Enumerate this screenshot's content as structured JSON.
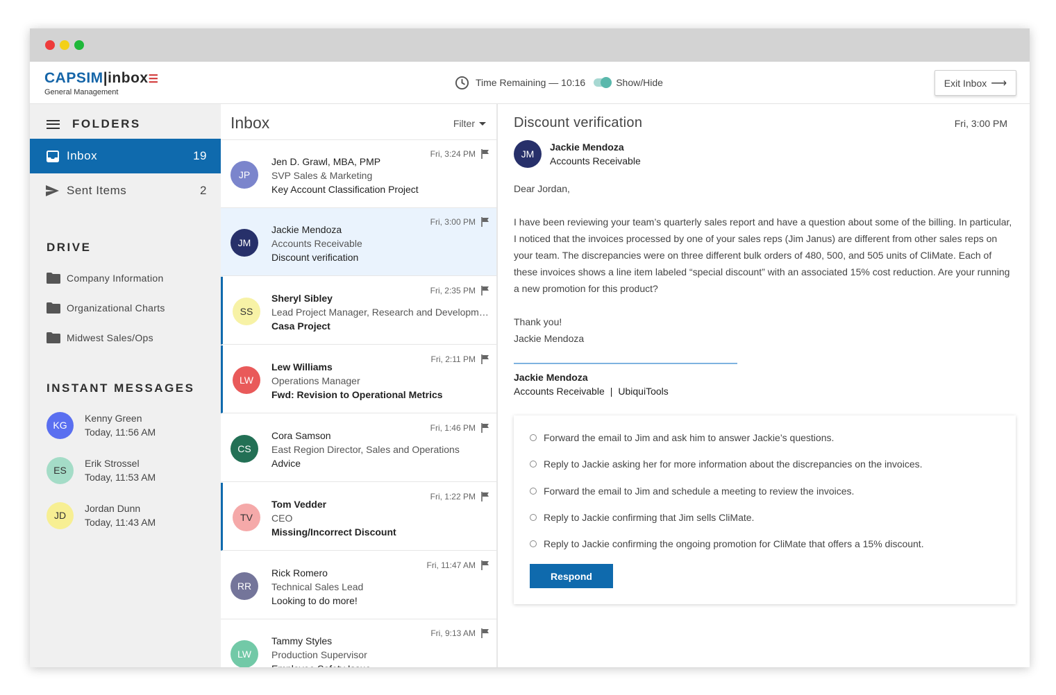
{
  "header": {
    "logo_brand": "CAPSIM",
    "logo_product": "inbox",
    "logo_subtitle": "General Management",
    "timer_label": "Time Remaining — 10:16",
    "toggle_label": "Show/Hide",
    "exit_label": "Exit Inbox",
    "colors": {
      "brand": "#1565a8",
      "toggle": "#5ab8ac"
    }
  },
  "sidebar": {
    "folders_title": "FOLDERS",
    "folders": [
      {
        "label": "Inbox",
        "count": "19",
        "icon": "inbox-icon",
        "active": true
      },
      {
        "label": "Sent Items",
        "count": "2",
        "icon": "send-icon",
        "active": false
      }
    ],
    "drive_title": "DRIVE",
    "drive": [
      {
        "label": "Company Information",
        "icon": "folder-icon"
      },
      {
        "label": "Organizational Charts",
        "icon": "folder-icon"
      },
      {
        "label": "Midwest Sales/Ops",
        "icon": "folder-icon"
      }
    ],
    "im_title": "INSTANT MESSAGES",
    "messages": [
      {
        "initials": "KG",
        "name": "Kenny Green",
        "time": "Today, 11:56 AM",
        "bg": "#5a6ff0",
        "fg": "#ffffff"
      },
      {
        "initials": "ES",
        "name": "Erik Strossel",
        "time": "Today, 11:53 AM",
        "bg": "#a4dcc7",
        "fg": "#333333"
      },
      {
        "initials": "JD",
        "name": "Jordan Dunn",
        "time": "Today, 11:43 AM",
        "bg": "#f7ef93",
        "fg": "#333333"
      }
    ]
  },
  "inbox": {
    "title": "Inbox",
    "filter_label": "Filter",
    "messages": [
      {
        "initials": "JP",
        "from": "Jen D. Grawl, MBA, PMP",
        "role": "SVP Sales & Marketing",
        "subject": "Key Account Classification Project",
        "time": "Fri, 3:24 PM",
        "bg": "#7b85cc",
        "fg": "#ffffff"
      },
      {
        "initials": "JM",
        "from": "Jackie Mendoza",
        "role": "Accounts Receivable",
        "subject": "Discount verification",
        "time": "Fri, 3:00 PM",
        "bg": "#27306a",
        "fg": "#ffffff"
      },
      {
        "initials": "SS",
        "from": "Sheryl Sibley",
        "role": "Lead Project Manager, Research and Development",
        "subject": "Casa Project",
        "time": "Fri, 2:35 PM",
        "bg": "#f7f2a6",
        "fg": "#333333"
      },
      {
        "initials": "LW",
        "from": "Lew Williams",
        "role": "Operations Manager",
        "subject": "Fwd: Revision to Operational Metrics",
        "time": "Fri, 2:11 PM",
        "bg": "#e95a5a",
        "fg": "#ffffff"
      },
      {
        "initials": "CS",
        "from": "Cora Samson",
        "role": "East Region Director, Sales and Operations",
        "subject": "Advice",
        "time": "Fri, 1:46 PM",
        "bg": "#237055",
        "fg": "#ffffff"
      },
      {
        "initials": "TV",
        "from": "Tom Vedder",
        "role": "CEO",
        "subject": "Missing/Incorrect Discount",
        "time": "Fri, 1:22 PM",
        "bg": "#f5a9a9",
        "fg": "#333333"
      },
      {
        "initials": "RR",
        "from": "Rick Romero",
        "role": "Technical Sales Lead",
        "subject": "Looking to do more!",
        "time": "Fri, 11:47 AM",
        "bg": "#74759a",
        "fg": "#ffffff"
      },
      {
        "initials": "LW",
        "from": "Tammy Styles",
        "role": "Production Supervisor",
        "subject": "Employee Safety Issue",
        "time": "Fri, 9:13 AM",
        "bg": "#72c9a7",
        "fg": "#ffffff"
      }
    ]
  },
  "reader": {
    "subject": "Discount verification",
    "date": "Fri, 3:00 PM",
    "sender_initials": "JM",
    "sender_name": "Jackie Mendoza",
    "sender_role": "Accounts Receivable",
    "greeting": "Dear Jordan,",
    "body": "I have been reviewing your team’s quarterly sales report and have a question about some of the billing. In particular, I noticed that the invoices processed by one of your sales reps (Jim Janus) are different from other sales reps on your team. The discrepancies were on three different bulk orders of 480, 500, and 505 units of CliMate. Each of these invoices shows a line item labeled “special discount” with an associated 15% cost reduction. Are your running a new promotion for this product?",
    "closing": "Thank you!",
    "closing_name": "Jackie Mendoza",
    "sig_name": "Jackie Mendoza",
    "sig_dept": "Accounts Receivable",
    "sig_sep": "|",
    "sig_company": "UbiquiTools",
    "options": [
      "Forward the email to Jim and ask him to answer Jackie’s questions.",
      "Reply to Jackie asking her for more information about the discrepancies on the invoices.",
      "Forward the email to Jim and schedule a meeting to review the invoices.",
      "Reply to Jackie confirming that Jim sells CliMate.",
      "Reply to Jackie confirming the ongoing promotion for CliMate that offers a 15% discount."
    ],
    "respond_label": "Respond"
  }
}
